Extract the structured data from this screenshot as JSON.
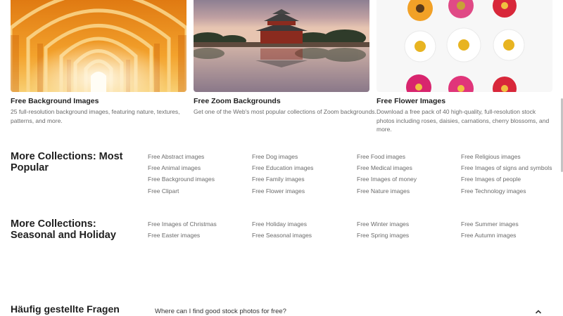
{
  "cards": [
    {
      "icon": "arched-corridor-photo",
      "title": "Free Background Images",
      "description": "25 full-resolution background images, featuring nature, textures, patterns, and more."
    },
    {
      "icon": "forbidden-city-photo",
      "title": "Free Zoom Backgrounds",
      "description": "Get one of the Web's most popular collections of Zoom backgrounds."
    },
    {
      "icon": "flowers-photo",
      "title": "Free Flower Images",
      "description": "Download a free pack of 40 high-quality, full-resolution stock photos including roses, daisies, carnations, cherry blossoms, and more."
    }
  ],
  "popular": {
    "title": "More Collections: Most Popular",
    "columns": [
      [
        "Free Abstract images",
        "Free Animal images",
        "Free Background images",
        "Free Clipart"
      ],
      [
        "Free Dog images",
        "Free Education images",
        "Free Family images",
        "Free Flower images"
      ],
      [
        "Free Food images",
        "Free Medical images",
        "Free Images of money",
        "Free Nature images"
      ],
      [
        "Free Religious images",
        "Free Images of signs and symbols",
        "Free Images of people",
        "Free Technology images"
      ]
    ]
  },
  "seasonal": {
    "title": "More Collections: Seasonal and Holiday",
    "columns": [
      [
        "Free Images of Christmas",
        "Free Easter images"
      ],
      [
        "Free Holiday images",
        "Free Seasonal images"
      ],
      [
        "Free Winter images",
        "Free Spring images"
      ],
      [
        "Free Summer images",
        "Free Autumn images"
      ]
    ]
  },
  "faq": {
    "title": "Häufig gestellte Fragen",
    "question": "Where can I find good stock photos for free?",
    "toggle_icon": "chevron-up-icon"
  },
  "colors": {
    "title": "#1f1f1f",
    "muted": "#6b6b6b"
  }
}
